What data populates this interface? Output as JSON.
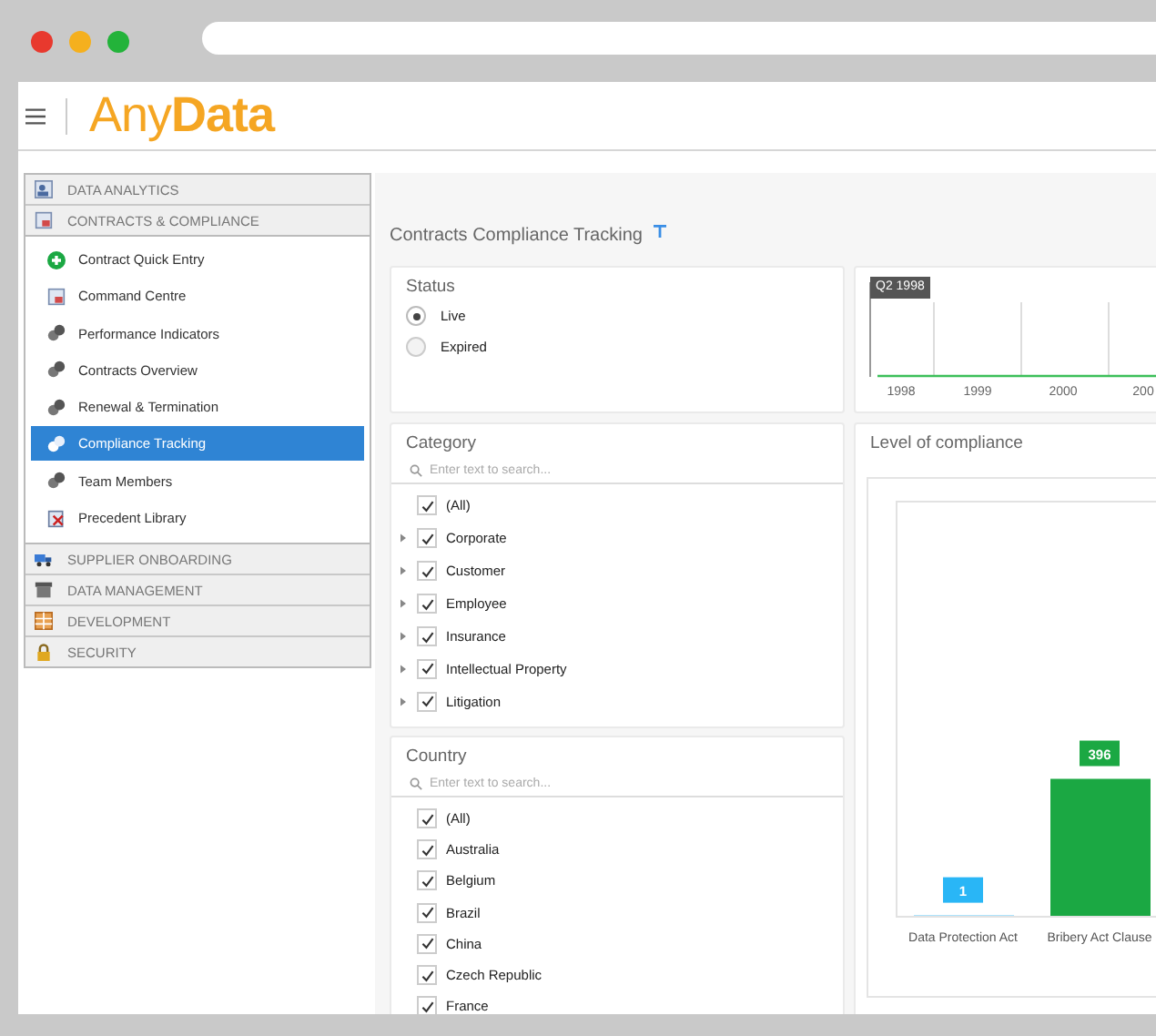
{
  "header": {
    "logo": "Any**Data**"
  },
  "sidebar": {
    "sections": [
      {
        "label": "DATA ANALYTICS",
        "kind": "people",
        "expanded": false
      },
      {
        "label": "CONTRACTS & COMPLIANCE",
        "kind": "page",
        "expanded": true,
        "items": [
          {
            "label": "Contract Quick Entry",
            "kind": "plus",
            "selected": false
          },
          {
            "label": "Command Centre",
            "kind": "page",
            "selected": false
          },
          {
            "label": "Performance Indicators",
            "kind": "gears",
            "selected": false
          },
          {
            "label": "Contracts Overview",
            "kind": "gears",
            "selected": false
          },
          {
            "label": "Renewal & Termination",
            "kind": "gears",
            "selected": false
          },
          {
            "label": "Compliance Tracking",
            "kind": "gears",
            "selected": true
          },
          {
            "label": "Team Members",
            "kind": "gears",
            "selected": false
          },
          {
            "label": "Precedent Library",
            "kind": "book",
            "selected": false
          }
        ]
      },
      {
        "label": "SUPPLIER ONBOARDING",
        "kind": "truck",
        "expanded": false
      },
      {
        "label": "DATA MANAGEMENT",
        "kind": "box",
        "expanded": false
      },
      {
        "label": "DEVELOPMENT",
        "kind": "grid",
        "expanded": false
      },
      {
        "label": "SECURITY",
        "kind": "lock",
        "expanded": false
      }
    ]
  },
  "page_title": "Contracts Compliance Tracking",
  "status": {
    "title": "Status",
    "options": [
      {
        "label": "Live",
        "selected": true
      },
      {
        "label": "Expired",
        "selected": false
      }
    ]
  },
  "timeline": {
    "selection_label": "Q2 1998",
    "years": [
      "1998",
      "1999",
      "2000",
      "200"
    ]
  },
  "category": {
    "title": "Category",
    "search": {
      "placeholder": "Enter text to search..."
    },
    "items": [
      {
        "label": "(All)",
        "checked": true,
        "expandable": false
      },
      {
        "label": "Corporate",
        "checked": true,
        "expandable": true
      },
      {
        "label": "Customer",
        "checked": true,
        "expandable": true
      },
      {
        "label": "Employee",
        "checked": true,
        "expandable": true
      },
      {
        "label": "Insurance",
        "checked": true,
        "expandable": true
      },
      {
        "label": "Intellectual Property",
        "checked": true,
        "expandable": true
      },
      {
        "label": "Litigation",
        "checked": true,
        "expandable": true
      }
    ]
  },
  "country": {
    "title": "Country",
    "search": {
      "placeholder": "Enter text to search..."
    },
    "items": [
      {
        "label": "(All)",
        "checked": true
      },
      {
        "label": "Australia",
        "checked": true
      },
      {
        "label": "Belgium",
        "checked": true
      },
      {
        "label": "Brazil",
        "checked": true
      },
      {
        "label": "China",
        "checked": true
      },
      {
        "label": "Czech Republic",
        "checked": true
      },
      {
        "label": "France",
        "checked": true
      }
    ]
  },
  "compliance": {
    "title": "Level of compliance",
    "chart_data": {
      "type": "bar",
      "categories": [
        "Data Protection Act",
        "Bribery Act Clause"
      ],
      "data_labels": true,
      "values": [
        1,
        396
      ]
    }
  }
}
